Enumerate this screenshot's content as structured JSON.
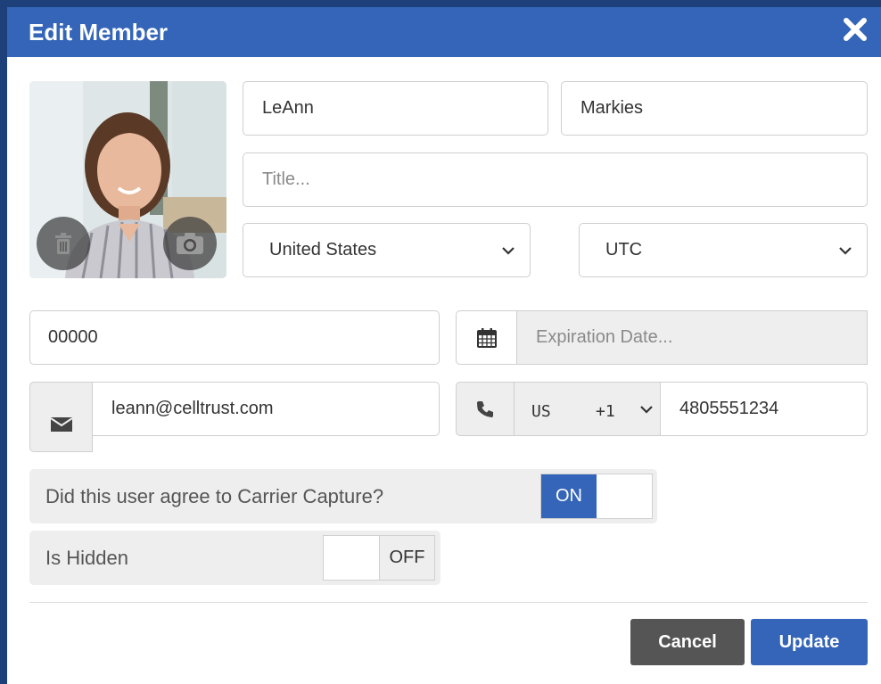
{
  "dialog": {
    "title": "Edit Member"
  },
  "form": {
    "first_name": "LeAnn",
    "last_name": "Markies",
    "title_placeholder": "Title...",
    "country": "United States",
    "timezone": "UTC",
    "member_id": "00000",
    "expiration_placeholder": "Expiration Date...",
    "email": "leann@celltrust.com",
    "phone_country": "US",
    "phone_code": "+1",
    "phone_number": "4805551234"
  },
  "toggles": {
    "carrier_capture": {
      "label": "Did this user agree to Carrier Capture?",
      "state_label": "ON"
    },
    "is_hidden": {
      "label": "Is Hidden",
      "state_label": "OFF"
    }
  },
  "actions": {
    "cancel_label": "Cancel",
    "update_label": "Update"
  },
  "colors": {
    "header": "#3465b8",
    "primary_button": "#3465b8",
    "cancel_button": "#555555",
    "backdrop": "#1d3f7a"
  }
}
